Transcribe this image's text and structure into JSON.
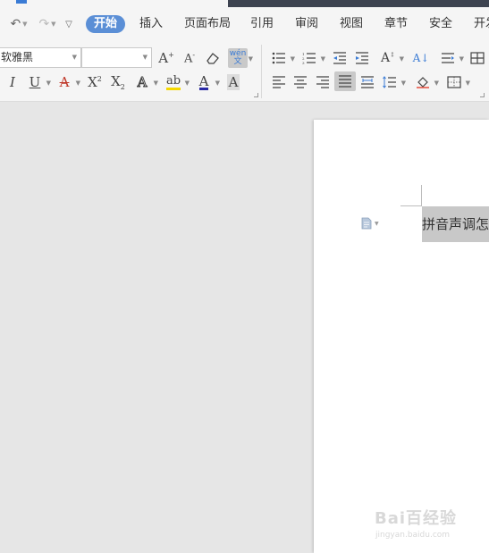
{
  "menu": {
    "tabs": [
      {
        "label": "开始",
        "active": true
      },
      {
        "label": "插入"
      },
      {
        "label": "页面布局"
      },
      {
        "label": "引用"
      },
      {
        "label": "审阅"
      },
      {
        "label": "视图"
      },
      {
        "label": "章节"
      },
      {
        "label": "安全"
      },
      {
        "label": "开发"
      }
    ],
    "accent": "#5b8fd6"
  },
  "ribbon": {
    "font_name": "软雅黑",
    "font_size": "",
    "phonetic_icon_text": "wén 文"
  },
  "document": {
    "selected_text": "拼音声调怎"
  },
  "watermark": {
    "main": "Bai百经验",
    "sub": "jingyan.baidu.com"
  }
}
